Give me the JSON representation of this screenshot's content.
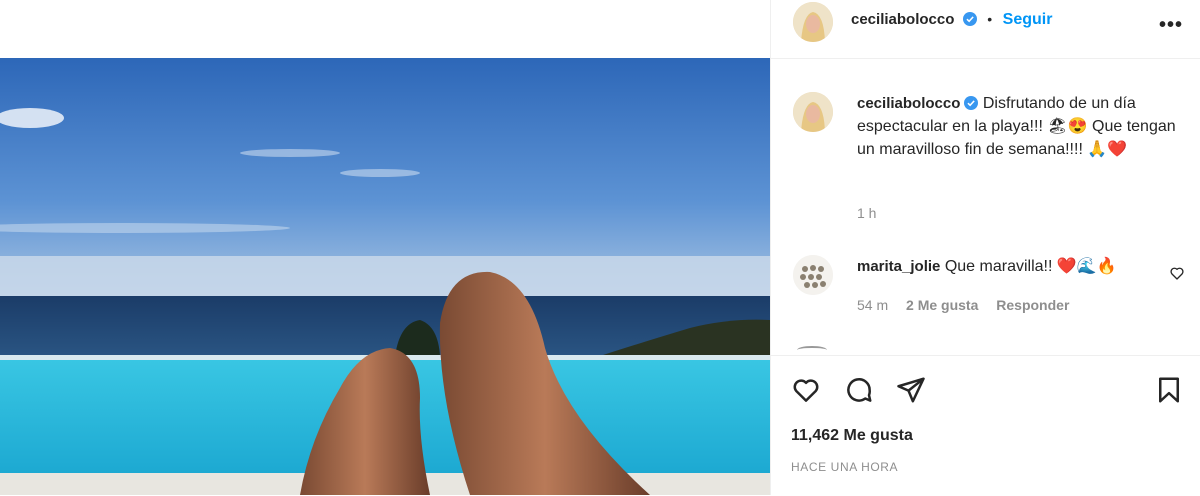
{
  "post": {
    "image_alt": "Vista de piernas frente a una piscina infinita y el mar"
  },
  "header": {
    "username": "ceciliabolocco",
    "separator": "•",
    "follow_label": "Seguir",
    "more_label": "•••"
  },
  "caption": {
    "username": "ceciliabolocco",
    "text": "Disfrutando de un día espectacular en la playa!!! 🏖😍 Que tengan un maravilloso fin de semana!!!! 🙏❤️",
    "time": "1 h"
  },
  "comments": [
    {
      "username": "marita_jolie",
      "text": "Que maravilla!! ❤️🌊🔥",
      "time": "54 m",
      "likes": "2 Me gusta",
      "reply_label": "Responder"
    }
  ],
  "actions": {
    "likes_count": "11,462 Me gusta",
    "posted_ago": "HACE UNA HORA"
  },
  "colors": {
    "link_blue": "#0095f6",
    "text": "#262626",
    "muted": "#8e8e8e",
    "verified": "#3897f0"
  }
}
